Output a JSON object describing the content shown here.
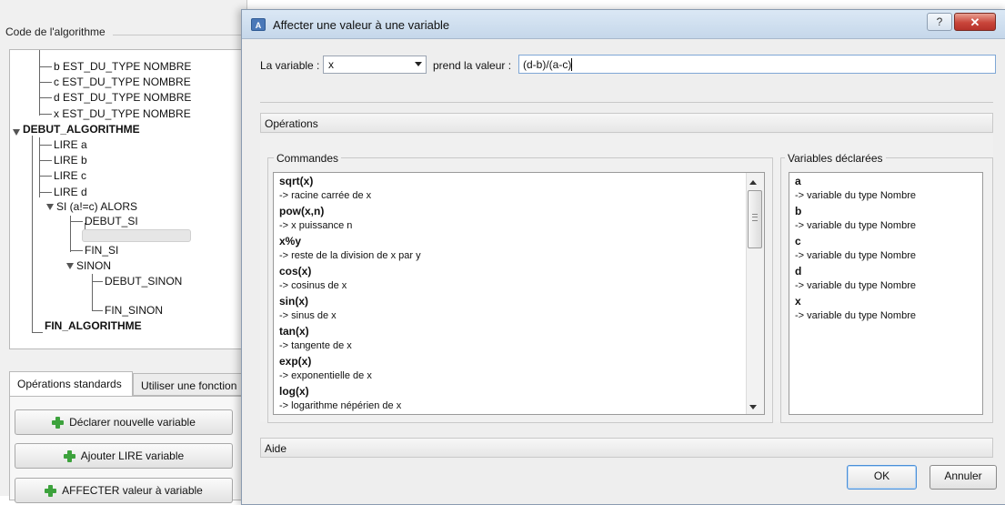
{
  "left_panel": {
    "header": "Code de l'algorithme",
    "tree": [
      {
        "text": "b EST_DU_TYPE NOMBRE",
        "bold": false
      },
      {
        "text": "c EST_DU_TYPE NOMBRE",
        "bold": false
      },
      {
        "text": "d EST_DU_TYPE NOMBRE",
        "bold": false
      },
      {
        "text": "x EST_DU_TYPE NOMBRE",
        "bold": false
      },
      {
        "text": "DEBUT_ALGORITHME",
        "bold": true
      },
      {
        "text": "LIRE a",
        "bold": false
      },
      {
        "text": "LIRE b",
        "bold": false
      },
      {
        "text": "LIRE c",
        "bold": false
      },
      {
        "text": "LIRE d",
        "bold": false
      },
      {
        "text": "SI (a!=c) ALORS",
        "bold": false
      },
      {
        "text": "DEBUT_SI",
        "bold": false
      },
      {
        "text": "FIN_SI",
        "bold": false
      },
      {
        "text": "SINON",
        "bold": false
      },
      {
        "text": "DEBUT_SINON",
        "bold": false
      },
      {
        "text": "FIN_SINON",
        "bold": false
      },
      {
        "text": "FIN_ALGORITHME",
        "bold": true
      }
    ],
    "tabs": [
      "Opérations standards",
      "Utiliser une fonction"
    ],
    "buttons": [
      "Déclarer nouvelle variable",
      "Ajouter LIRE variable",
      "AFFECTER valeur à variable"
    ]
  },
  "dialog": {
    "title": "Affecter une valeur à une variable",
    "app_icon": "A",
    "help_symbol": "?",
    "close_symbol": "✕",
    "variable_label": "La variable :",
    "variable_selected": "x",
    "value_label": "prend la valeur :",
    "value_text": "(d-b)/(a-c)",
    "operations_label": "Opérations",
    "commands_label": "Commandes",
    "commands": [
      {
        "cmd": "sqrt(x)",
        "desc": "-> racine carrée de x"
      },
      {
        "cmd": "pow(x,n)",
        "desc": "-> x puissance n"
      },
      {
        "cmd": "x%y",
        "desc": "-> reste de la division de x par y"
      },
      {
        "cmd": "cos(x)",
        "desc": "-> cosinus de x"
      },
      {
        "cmd": "sin(x)",
        "desc": "-> sinus de x"
      },
      {
        "cmd": "tan(x)",
        "desc": "-> tangente de x"
      },
      {
        "cmd": "exp(x)",
        "desc": "-> exponentielle de x"
      },
      {
        "cmd": "log(x)",
        "desc": "-> logarithme népérien de x"
      }
    ],
    "variables_label": "Variables déclarées",
    "variables": [
      {
        "name": "a",
        "desc": "-> variable du type Nombre"
      },
      {
        "name": "b",
        "desc": "-> variable du type Nombre"
      },
      {
        "name": "c",
        "desc": "-> variable du type Nombre"
      },
      {
        "name": "d",
        "desc": "-> variable du type Nombre"
      },
      {
        "name": "x",
        "desc": "-> variable du type Nombre"
      }
    ],
    "aide_label": "Aide",
    "ok_label": "OK",
    "cancel_label": "Annuler"
  },
  "icons": {
    "add_button_icon": "plus-icon",
    "tree_expand_icon": "triangle-down-icon",
    "dropdown_icon": "chevron-down-icon"
  },
  "colors": {
    "plus_icon": "#3da23d",
    "close_button": "#c9453a",
    "titlebar": "#c5d7ea"
  }
}
